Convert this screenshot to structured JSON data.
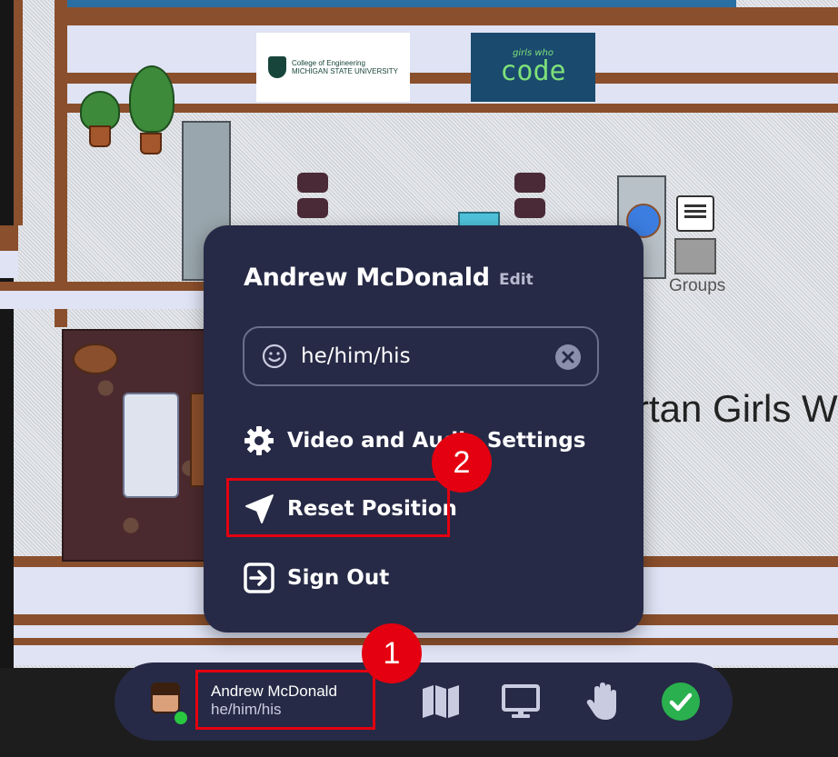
{
  "logos": {
    "msu_line1": "College of Engineering",
    "msu_line2": "MICHIGAN STATE UNIVERSITY",
    "gwc_small": "girls who",
    "gwc_big": "code"
  },
  "map": {
    "groups_label": "Groups",
    "banner_text": "rtan Girls W"
  },
  "popup": {
    "user_name": "Andrew McDonald",
    "edit_label": "Edit",
    "pronouns_value": "he/him/his",
    "menu": {
      "video_audio": "Video and Audio Settings",
      "reset_position": "Reset Position",
      "sign_out": "Sign Out"
    }
  },
  "annotations": {
    "badge_1": "1",
    "badge_2": "2"
  },
  "bottom_bar": {
    "user_name": "Andrew McDonald",
    "pronouns": "he/him/his"
  },
  "colors": {
    "panel_bg": "#262a46",
    "highlight": "#e40010",
    "status_online": "#28c840",
    "check_green": "#2ab04e"
  }
}
